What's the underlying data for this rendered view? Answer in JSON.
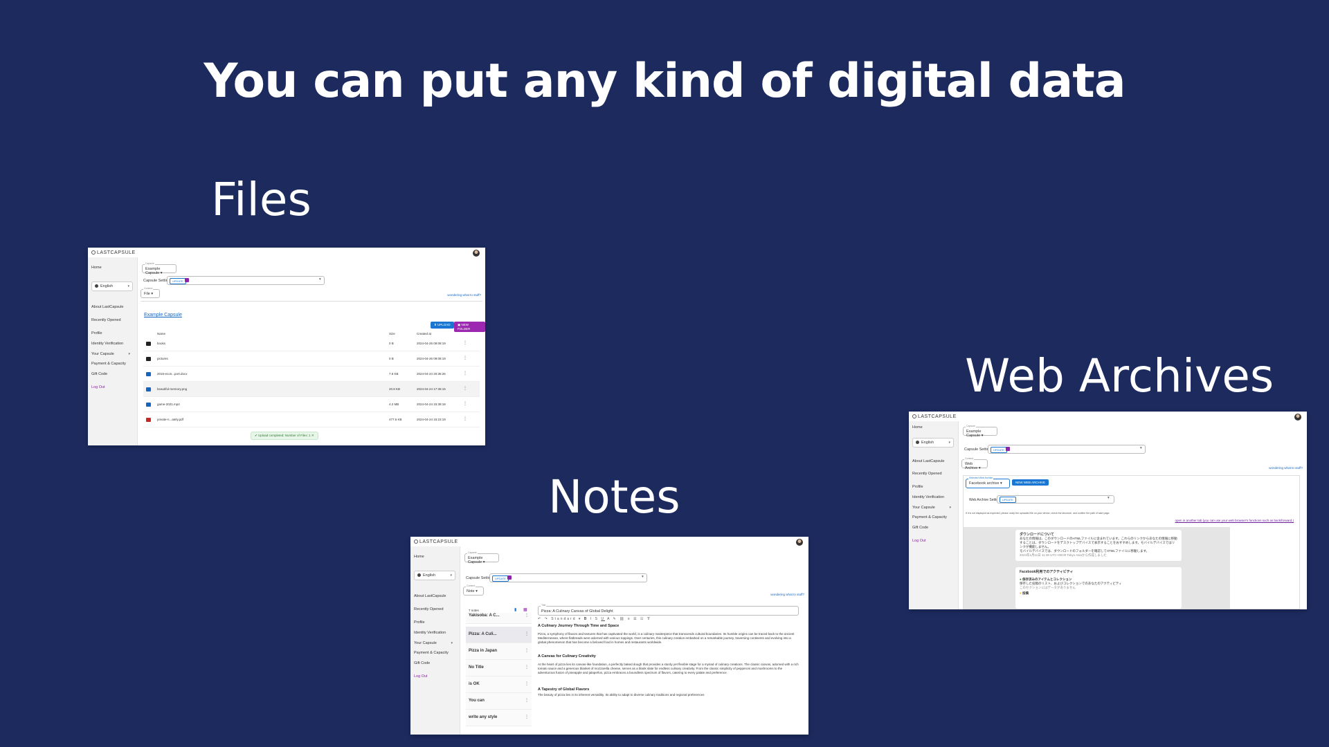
{
  "headline": "You can put any kind of digital data",
  "sections": {
    "files": "Files",
    "notes": "Notes",
    "web_archives": "Web Archives"
  },
  "app": {
    "brand": "LASTCAPSULE",
    "sidebar": {
      "home": "Home",
      "language": "English",
      "about": "About LastCapsule",
      "recent": "Recently Opened",
      "profile": "Profile",
      "identity": "Identity Verification",
      "your_capsule": "Your Capsule",
      "payment": "Payment & Capacity",
      "gift": "Gift Code",
      "logout": "Log Out"
    },
    "capsule_label": "Capsule",
    "capsule_value": "Example Capsule",
    "capsule_setting": "Capsule Setting",
    "update": "UPDATE",
    "content_label": "Content",
    "wondering": "wondering what to stuff?"
  },
  "files": {
    "content_type": "File",
    "folder_link": "Example Capsule",
    "upload": "UPLOAD",
    "new_folder": "NEW FOLDER",
    "columns": {
      "name": "Name",
      "size": "Size",
      "created": "Created at"
    },
    "rows": [
      {
        "name": "books",
        "size": "0 B",
        "created": "2024-04-26 09:08:19",
        "icon": "folder-icon"
      },
      {
        "name": "pictures",
        "size": "0 B",
        "created": "2024-04-26 09:08:19",
        "icon": "folder-icon"
      },
      {
        "name": "2015-econ...port.docx",
        "size": "7.6 KB",
        "created": "2024-04-24 20:36:26",
        "icon": "doc-icon"
      },
      {
        "name": "beautiful-memory.png",
        "size": "20.8 KB",
        "created": "2024-04-24 17:36:15",
        "icon": "image-icon"
      },
      {
        "name": "game-2021.mp4",
        "size": "4.2 MB",
        "created": "2024-04-24 15:38:18",
        "icon": "video-icon"
      },
      {
        "name": "private-n...ately.pdf",
        "size": "477.5 KB",
        "created": "2024-04-24 15:23:19",
        "icon": "pdf-icon"
      }
    ],
    "toast": "Upload completed: Number of Files: 1"
  },
  "notes": {
    "content_type": "Note",
    "count": "7 notes",
    "items": [
      "Yakisoba: A C...",
      "Pizza: A Culi...",
      "Pizza in Japan",
      "No Title",
      "is OK",
      "You can",
      "write any style"
    ],
    "title_label": "Title",
    "title_value": "Pizza: A Culinary Canvas of Global Delight",
    "style_value": "Standard",
    "h1": "A Culinary Journey Through Time and Space",
    "p1": "Pizza, a symphony of flavors and textures that has captivated the world, is a culinary masterpiece that transcends cultural boundaries. Its humble origins can be traced back to the ancient Mediterranean, where flatbreads were adorned with various toppings. Over centuries, this culinary creation embarked on a remarkable journey, traversing continents and evolving into a global phenomenon that has become a beloved food in homes and restaurants worldwide.",
    "h2": "A Canvas for Culinary Creativity",
    "p2": "At the heart of pizza lies its canvas-like foundation, a perfectly baked dough that provides a sturdy yet flexible stage for a myriad of culinary creations. The classic canvas, adorned with a rich tomato sauce and a generous blanket of mozzarella cheese, serves as a blank slate for endless culinary creativity. From the classic simplicity of pepperoni and mushrooms to the adventurous fusion of pineapple and jalapeños, pizza embraces a boundless spectrum of flavors, catering to every palate and preference.",
    "h3": "A Tapestry of Global Flavors",
    "p3": "The beauty of pizza lies in its inherent versatility. Its ability to adapt to diverse culinary traditions and regional preferences"
  },
  "web_archives": {
    "content_type": "Web Archive",
    "archive_label": "Selected Web Archive",
    "archive_value": "Facebook archive",
    "new_button": "NEW WEB ARCHIVE",
    "setting": "Web Archive Setting",
    "hint": "If it is not displayed as expected, please unzip the uploaded file on your device, check the structure, and confirm the path of start page.",
    "open_link": "open in another tab (you can use your web browser's functions such as back/forward.)",
    "card1_title": "ダウンロードについて",
    "card1_text": "あなたの情報は、このダウンロードのHTMLファイルに含まれています。これらのリンクからあなたの情報に移動することは、ダウンロードをデスクトップデバイスで表示することをおすすめします。モバイルデバイスではリンクが機能しません。",
    "card1_more": "モバイルデバイスでは、ダウンロードのフォルダーを確認してHTMLファイルに移動します。",
    "card1_date": "2024年1月11日 11:36 UTC+09:00 Tokyo Asiaから作成しました",
    "card2_title": "Facebook利用でのアクティビティ",
    "card2_item1": "保存済みのアイテムとコレクション",
    "card2_item1_sub": "保存した投稿のリスト、およびコレクションでのあなたのアクティビティ",
    "card2_item1_note": "このセクションにはデータがありません",
    "card2_item2": "投稿"
  }
}
